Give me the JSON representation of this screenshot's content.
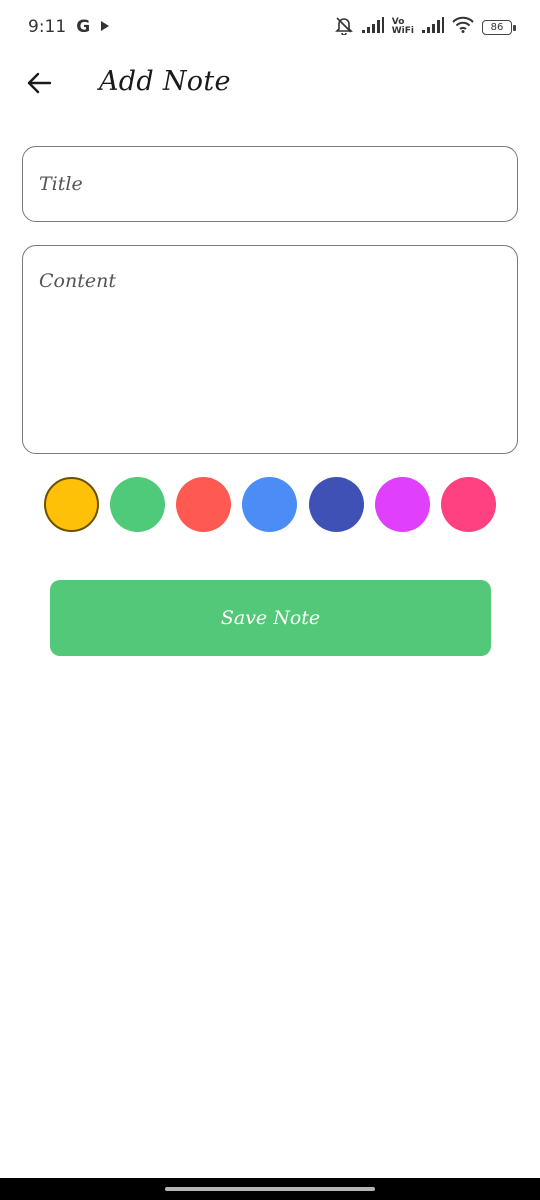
{
  "status_bar": {
    "time": "9:11",
    "left_icons": [
      "google-g-icon",
      "play-store-icon"
    ],
    "google_glyph": "G",
    "vowifi_top": "Vo",
    "vowifi_bottom": "WiFi",
    "battery": "86",
    "right_icons": [
      "mute-bell-icon",
      "signal-icon",
      "signal-icon",
      "wifi-icon",
      "battery-icon"
    ]
  },
  "app_bar": {
    "title": "Add Note",
    "back_icon": "arrow-left-icon"
  },
  "form": {
    "title_placeholder": "Title",
    "title_value": "",
    "content_placeholder": "Content",
    "content_value": ""
  },
  "colors": {
    "selected": "#FFC107",
    "options": [
      "#FFC107",
      "#4FC97A",
      "#FF5A52",
      "#4B8CF7",
      "#3F51B5",
      "#E040FB",
      "#FF4081"
    ],
    "selected_border": "#6B5100"
  },
  "save_button": {
    "label": "Save Note",
    "color": "#52C878"
  }
}
